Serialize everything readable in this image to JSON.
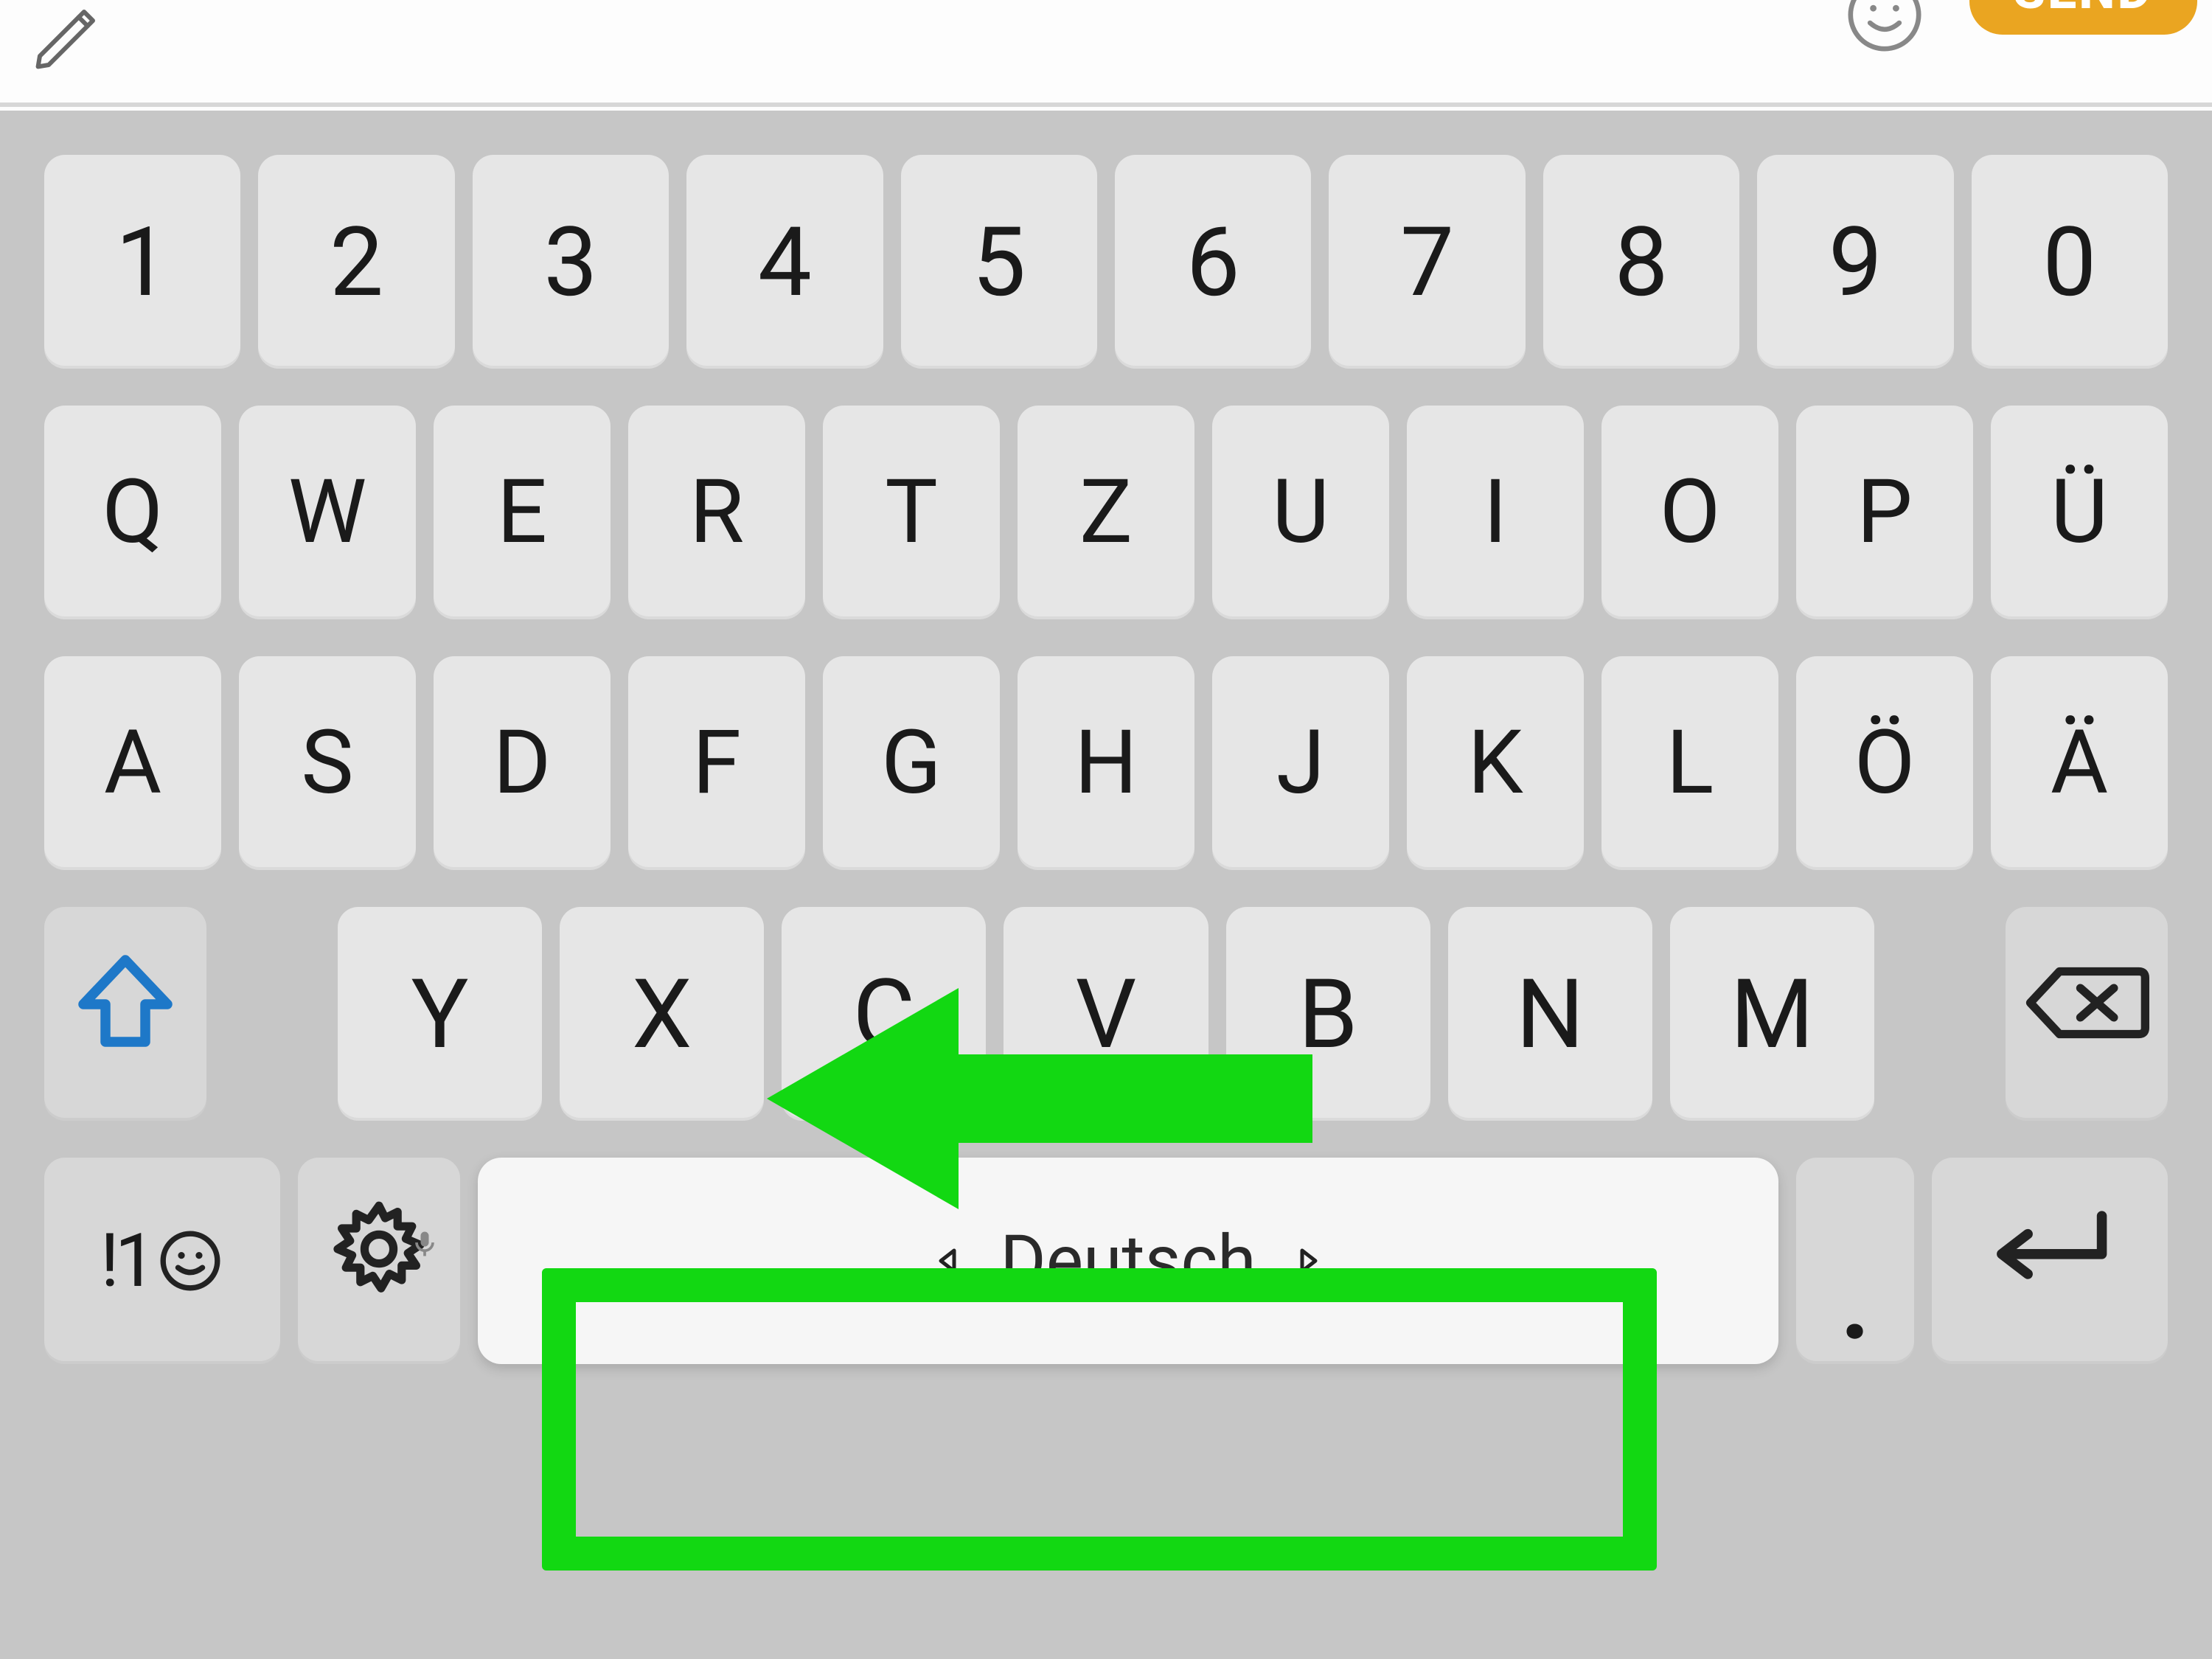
{
  "topbar": {
    "send_label": "SEND"
  },
  "keyboard": {
    "row_numbers": [
      "1",
      "2",
      "3",
      "4",
      "5",
      "6",
      "7",
      "8",
      "9",
      "0"
    ],
    "row_q": [
      "Q",
      "W",
      "E",
      "R",
      "T",
      "Z",
      "U",
      "I",
      "O",
      "P",
      "Ü"
    ],
    "row_a": [
      "A",
      "S",
      "D",
      "F",
      "G",
      "H",
      "J",
      "K",
      "L",
      "Ö",
      "Ä"
    ],
    "row_y": [
      "Y",
      "X",
      "C",
      "V",
      "B",
      "N",
      "M"
    ],
    "symbols_label_prefix": "!1",
    "space_language": "Deutsch",
    "period_label": "."
  },
  "annotations": {
    "arrow_points_to": "space-key",
    "highlight_target": "space-key"
  },
  "colors": {
    "send_button": "#eaa521",
    "annotation_green": "#12d812",
    "shift_outline": "#1e78c8",
    "key_bg": "#e6e6e6",
    "mod_key_bg": "#d7d7d7",
    "kbd_bg": "#c6c6c6"
  }
}
